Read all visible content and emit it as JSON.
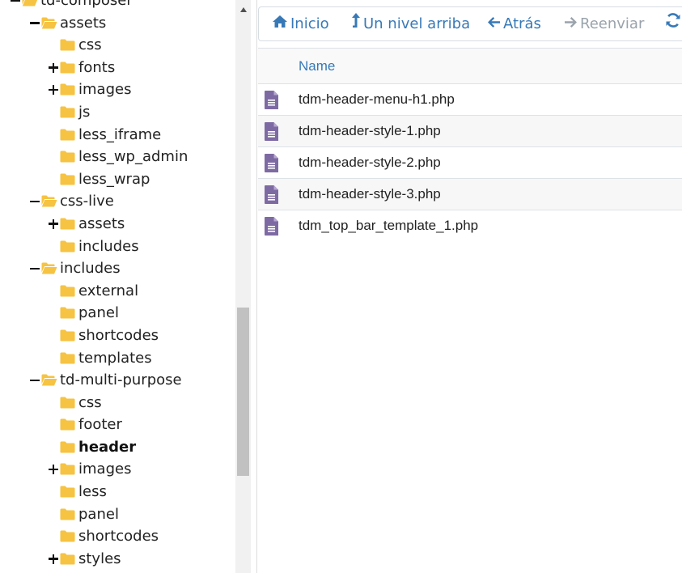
{
  "tree": [
    {
      "label": "td-composer",
      "indent": 0,
      "toggle": "minus",
      "folder": "open"
    },
    {
      "label": "assets",
      "indent": 1,
      "toggle": "minus",
      "folder": "open"
    },
    {
      "label": "css",
      "indent": 2,
      "toggle": "none",
      "folder": "closed"
    },
    {
      "label": "fonts",
      "indent": 2,
      "toggle": "plus",
      "folder": "closed"
    },
    {
      "label": "images",
      "indent": 2,
      "toggle": "plus",
      "folder": "closed"
    },
    {
      "label": "js",
      "indent": 2,
      "toggle": "none",
      "folder": "closed"
    },
    {
      "label": "less_iframe",
      "indent": 2,
      "toggle": "none",
      "folder": "closed"
    },
    {
      "label": "less_wp_admin",
      "indent": 2,
      "toggle": "none",
      "folder": "closed"
    },
    {
      "label": "less_wrap",
      "indent": 2,
      "toggle": "none",
      "folder": "closed"
    },
    {
      "label": "css-live",
      "indent": 1,
      "toggle": "minus",
      "folder": "open"
    },
    {
      "label": "assets",
      "indent": 2,
      "toggle": "plus",
      "folder": "closed"
    },
    {
      "label": "includes",
      "indent": 2,
      "toggle": "none",
      "folder": "closed"
    },
    {
      "label": "includes",
      "indent": 1,
      "toggle": "minus",
      "folder": "open"
    },
    {
      "label": "external",
      "indent": 2,
      "toggle": "none",
      "folder": "closed"
    },
    {
      "label": "panel",
      "indent": 2,
      "toggle": "none",
      "folder": "closed"
    },
    {
      "label": "shortcodes",
      "indent": 2,
      "toggle": "none",
      "folder": "closed"
    },
    {
      "label": "templates",
      "indent": 2,
      "toggle": "none",
      "folder": "closed"
    },
    {
      "label": "td-multi-purpose",
      "indent": 1,
      "toggle": "minus",
      "folder": "open"
    },
    {
      "label": "css",
      "indent": 2,
      "toggle": "none",
      "folder": "closed"
    },
    {
      "label": "footer",
      "indent": 2,
      "toggle": "none",
      "folder": "closed"
    },
    {
      "label": "header",
      "indent": 2,
      "toggle": "none",
      "folder": "closed",
      "selected": true
    },
    {
      "label": "images",
      "indent": 2,
      "toggle": "plus",
      "folder": "closed"
    },
    {
      "label": "less",
      "indent": 2,
      "toggle": "none",
      "folder": "closed"
    },
    {
      "label": "panel",
      "indent": 2,
      "toggle": "none",
      "folder": "closed"
    },
    {
      "label": "shortcodes",
      "indent": 2,
      "toggle": "none",
      "folder": "closed"
    },
    {
      "label": "styles",
      "indent": 2,
      "toggle": "plus",
      "folder": "closed"
    }
  ],
  "toolbar": {
    "home_label": "Inicio",
    "up_label": "Un nivel arriba",
    "back_label": "Atrás",
    "forward_label": "Reenviar",
    "forward_disabled": true
  },
  "file_list": {
    "column_name": "Name",
    "files": [
      {
        "name": "tdm-header-menu-h1.php",
        "icon": "file-text-icon"
      },
      {
        "name": "tdm-header-style-1.php",
        "icon": "file-text-icon"
      },
      {
        "name": "tdm-header-style-2.php",
        "icon": "file-text-icon"
      },
      {
        "name": "tdm-header-style-3.php",
        "icon": "file-text-icon"
      },
      {
        "name": "tdm_top_bar_template_1.php",
        "icon": "file-text-icon"
      }
    ]
  },
  "colors": {
    "accent_blue": "#3779b7",
    "folder_yellow": "#f6c342",
    "file_purple": "#7e6aa3",
    "disabled_gray": "#9aa3ab"
  }
}
